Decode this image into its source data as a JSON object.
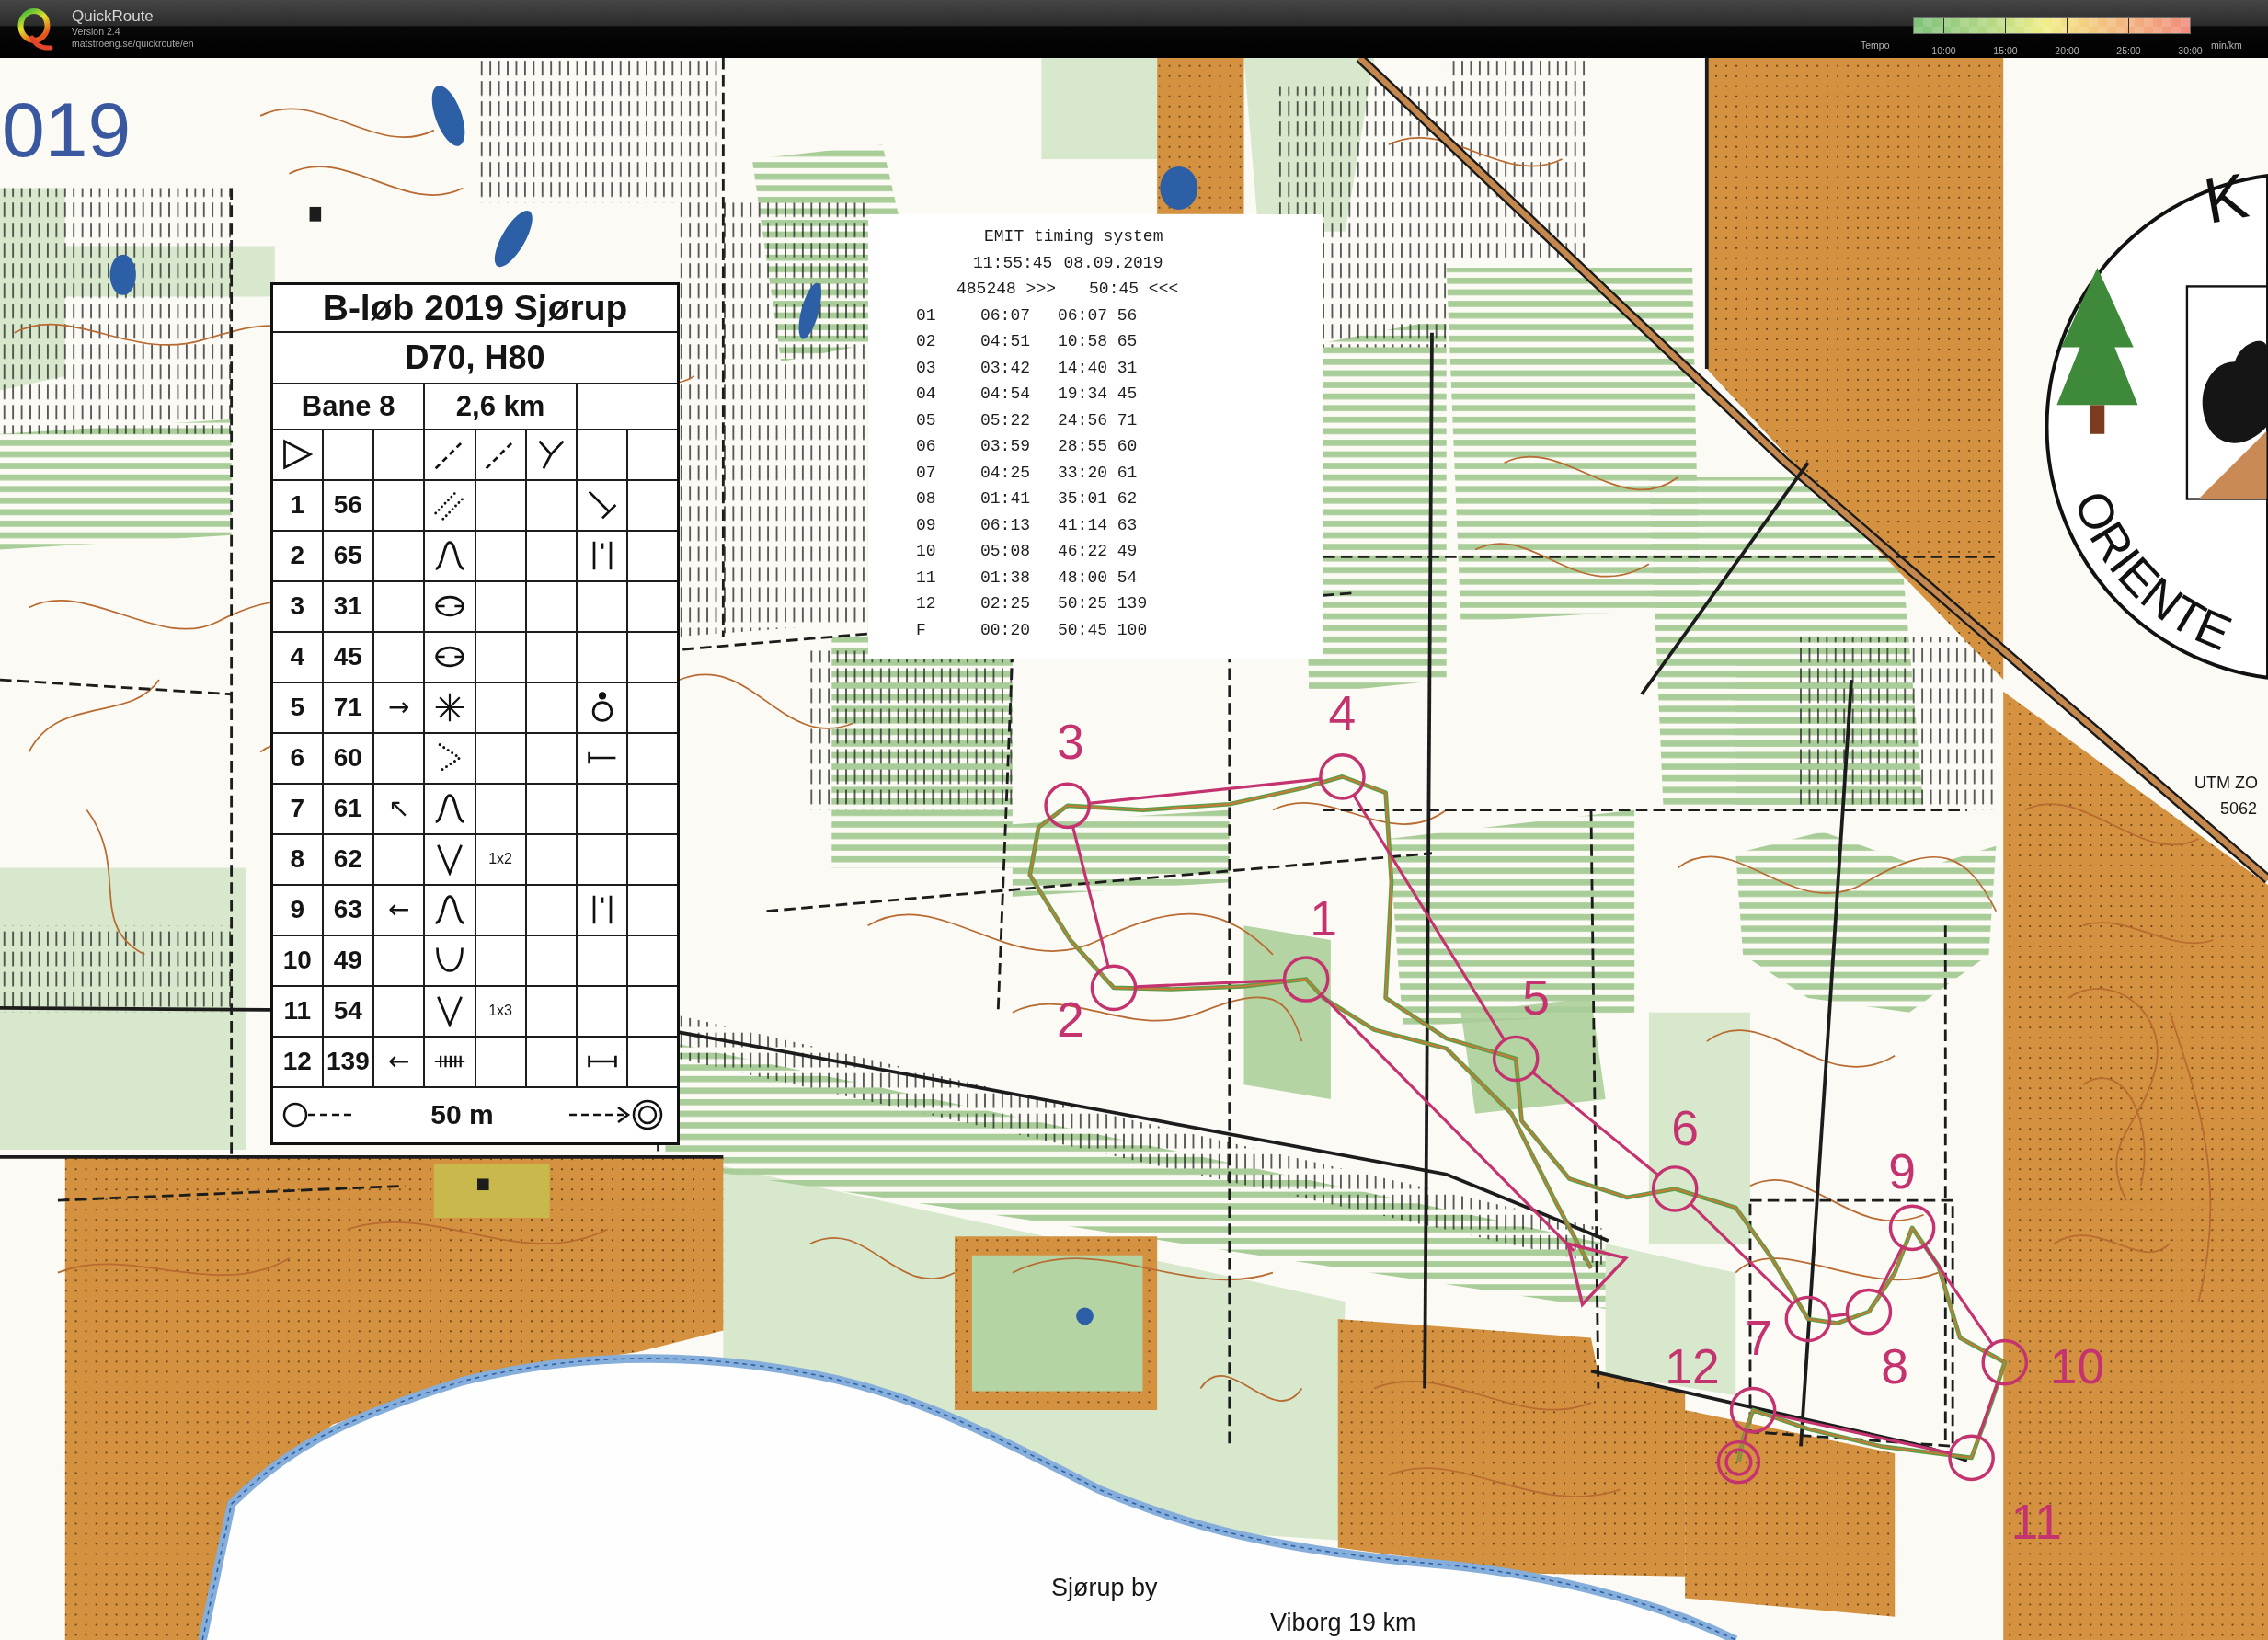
{
  "header": {
    "title": "QuickRoute",
    "version": "Version 2.4",
    "url": "matstroeng.se/quickroute/en"
  },
  "tempo_legend": {
    "label": "Tempo",
    "ticks": [
      "10:00",
      "15:00",
      "20:00",
      "25:00",
      "30:00"
    ],
    "unit": "min/km"
  },
  "map": {
    "labels": [
      {
        "kind": "heading",
        "text": "019"
      },
      {
        "kind": "place",
        "text": "Sjørup by"
      },
      {
        "kind": "road",
        "text": "Viborg 19 km"
      },
      {
        "kind": "grid",
        "text": "UTM ZO"
      },
      {
        "kind": "grid",
        "text": "5062"
      }
    ],
    "control_description": {
      "title": "B-løb 2019 Sjørup",
      "classes": "D70, H80",
      "course": "Bane 8",
      "length": "2,6 km",
      "rows": [
        {
          "column_1": {
            "kind": "triangle"
          },
          "column_4": {
            "kind": "dashes"
          },
          "column_5": {
            "kind": "dashes"
          },
          "column_6": {
            "kind": "fork"
          }
        },
        {
          "column_1": "1",
          "column_2": "56",
          "column_4": {
            "kind": "dots"
          },
          "column_7": {
            "kind": "tee"
          }
        },
        {
          "column_1": "2",
          "column_2": "65",
          "column_4": {
            "kind": "bell"
          },
          "column_7": {
            "kind": "bars"
          }
        },
        {
          "column_1": "3",
          "column_2": "31",
          "column_4": {
            "kind": "ring"
          }
        },
        {
          "column_1": "4",
          "column_2": "45",
          "column_4": {
            "kind": "ring"
          }
        },
        {
          "column_1": "5",
          "column_2": "71",
          "column_3": "→",
          "column_4": {
            "kind": "asterisk"
          },
          "column_7": {
            "kind": "dotring"
          }
        },
        {
          "column_1": "6",
          "column_2": "60",
          "column_4": {
            "kind": "chevron"
          },
          "column_7": {
            "kind": "endleft"
          }
        },
        {
          "column_1": "7",
          "column_2": "61",
          "column_3": "↖",
          "column_4": {
            "kind": "bell"
          }
        },
        {
          "column_1": "8",
          "column_2": "62",
          "column_4": {
            "kind": "vee"
          },
          "column_5": "1x2"
        },
        {
          "column_1": "9",
          "column_2": "63",
          "column_3": "←",
          "column_4": {
            "kind": "bell"
          },
          "column_7": {
            "kind": "bars"
          }
        },
        {
          "column_1": "10",
          "column_2": "49",
          "column_4": {
            "kind": "cup"
          }
        },
        {
          "column_1": "11",
          "column_2": "54",
          "column_4": {
            "kind": "vee"
          },
          "column_5": "1x3"
        },
        {
          "column_1": "12",
          "column_2": "139",
          "column_3": "←",
          "column_4": {
            "kind": "hash"
          },
          "column_7": {
            "kind": "span"
          }
        }
      ],
      "footer": "50 m"
    },
    "receipt": {
      "title": "EMIT timing system",
      "time": "11:55:45",
      "date": "08.09.2019",
      "card_number": "485248 >>>",
      "finish_time": "50:45 <<<",
      "splits": [
        {
          "control": "01",
          "split": "06:07",
          "elapsed": "06:07 56"
        },
        {
          "control": "02",
          "split": "04:51",
          "elapsed": "10:58 65"
        },
        {
          "control": "03",
          "split": "03:42",
          "elapsed": "14:40 31"
        },
        {
          "control": "04",
          "split": "04:54",
          "elapsed": "19:34 45"
        },
        {
          "control": "05",
          "split": "05:22",
          "elapsed": "24:56 71"
        },
        {
          "control": "06",
          "split": "03:59",
          "elapsed": "28:55 60"
        },
        {
          "control": "07",
          "split": "04:25",
          "elapsed": "33:20 61"
        },
        {
          "control": "08",
          "split": "01:41",
          "elapsed": "35:01 62"
        },
        {
          "control": "09",
          "split": "06:13",
          "elapsed": "41:14 63"
        },
        {
          "control": "10",
          "split": "05:08",
          "elapsed": "46:22 49"
        },
        {
          "control": "11",
          "split": "01:38",
          "elapsed": "48:00 54"
        },
        {
          "control": "12",
          "split": "02:25",
          "elapsed": "50:25 139"
        },
        {
          "control": "F",
          "split": "00:20",
          "elapsed": "50:45 100"
        }
      ]
    },
    "course": {
      "controls": [
        {
          "number": "1"
        },
        {
          "number": "2"
        },
        {
          "number": "3"
        },
        {
          "number": "4"
        },
        {
          "number": "5"
        },
        {
          "number": "6"
        },
        {
          "number": "7"
        },
        {
          "number": "8"
        },
        {
          "number": "9"
        },
        {
          "number": "10"
        },
        {
          "number": "11"
        },
        {
          "number": "12"
        }
      ]
    },
    "logo": {
      "top_text": "K",
      "ring_text": "ORIENTE"
    }
  }
}
